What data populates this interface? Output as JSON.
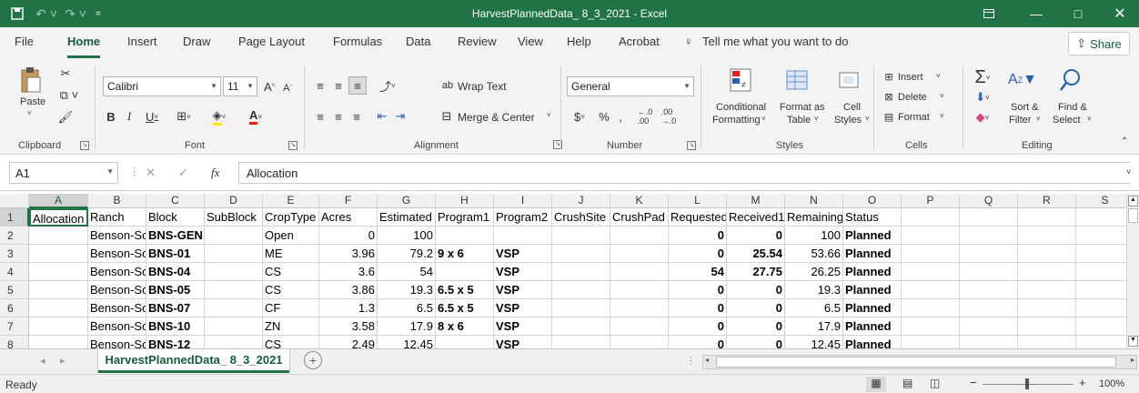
{
  "title_bar": {
    "title": "HarvestPlannedData_ 8_3_2021  -  Excel"
  },
  "tabs": [
    "File",
    "Home",
    "Insert",
    "Draw",
    "Page Layout",
    "Formulas",
    "Data",
    "Review",
    "View",
    "Help",
    "Acrobat"
  ],
  "active_tab": "Home",
  "tell_me": "Tell me what you want to do",
  "share_label": "Share",
  "ribbon": {
    "clipboard": {
      "label": "Clipboard",
      "paste": "Paste"
    },
    "font": {
      "label": "Font",
      "name": "Calibri",
      "size": "11"
    },
    "alignment": {
      "label": "Alignment",
      "wrap_text": "Wrap Text",
      "merge_center": "Merge & Center"
    },
    "number": {
      "label": "Number",
      "format": "General"
    },
    "styles": {
      "label": "Styles",
      "conditional_1": "Conditional",
      "conditional_2": "Formatting",
      "format_as_1": "Format as",
      "format_as_2": "Table",
      "cell_1": "Cell",
      "cell_2": "Styles"
    },
    "cells": {
      "label": "Cells",
      "insert": "Insert",
      "delete": "Delete",
      "format": "Format"
    },
    "editing": {
      "label": "Editing",
      "sort_1": "Sort &",
      "sort_2": "Filter",
      "find_1": "Find &",
      "find_2": "Select"
    }
  },
  "formula_bar": {
    "name_box": "A1",
    "fx": "fx",
    "content": "Allocation"
  },
  "columns": [
    "A",
    "B",
    "C",
    "D",
    "E",
    "F",
    "G",
    "H",
    "I",
    "J",
    "K",
    "L",
    "M",
    "N",
    "O",
    "P",
    "Q",
    "R",
    "S"
  ],
  "rows": [
    {
      "n": "1",
      "cells": [
        "Allocation",
        "Ranch",
        "Block",
        "SubBlock",
        "CropType",
        "Acres",
        "Estimated",
        "Program1",
        "Program2",
        "CrushSite",
        "CrushPad",
        "Requested",
        "Received1",
        "Remaining",
        "Status"
      ]
    },
    {
      "n": "2",
      "cells": [
        "",
        "Benson-Sonoma",
        "BNS-GEN",
        "",
        "Open",
        "0",
        "100",
        "",
        "",
        "",
        "",
        "0",
        "0",
        "100",
        "Planned"
      ]
    },
    {
      "n": "3",
      "cells": [
        "",
        "Benson-Sonoma",
        "BNS-01",
        "",
        "ME",
        "3.96",
        "79.2",
        "9 x 6",
        "VSP",
        "",
        "",
        "0",
        "25.54",
        "53.66",
        "Planned"
      ]
    },
    {
      "n": "4",
      "cells": [
        "",
        "Benson-Sonoma",
        "BNS-04",
        "",
        "CS",
        "3.6",
        "54",
        "",
        "VSP",
        "",
        "",
        "54",
        "27.75",
        "26.25",
        "Planned"
      ]
    },
    {
      "n": "5",
      "cells": [
        "",
        "Benson-Sonoma",
        "BNS-05",
        "",
        "CS",
        "3.86",
        "19.3",
        "6.5 x 5",
        "VSP",
        "",
        "",
        "0",
        "0",
        "19.3",
        "Planned"
      ]
    },
    {
      "n": "6",
      "cells": [
        "",
        "Benson-Sonoma",
        "BNS-07",
        "",
        "CF",
        "1.3",
        "6.5",
        "6.5 x 5",
        "VSP",
        "",
        "",
        "0",
        "0",
        "6.5",
        "Planned"
      ]
    },
    {
      "n": "7",
      "cells": [
        "",
        "Benson-Sonoma",
        "BNS-10",
        "",
        "ZN",
        "3.58",
        "17.9",
        "8 x 6",
        "VSP",
        "",
        "",
        "0",
        "0",
        "17.9",
        "Planned"
      ]
    },
    {
      "n": "8",
      "cells": [
        "",
        "Benson-Sonoma",
        "BNS-12",
        "",
        "CS",
        "2.49",
        "12.45",
        "",
        "VSP",
        "",
        "",
        "0",
        "0",
        "12.45",
        "Planned"
      ]
    }
  ],
  "sheet_tab": "HarvestPlannedData_ 8_3_2021",
  "status": {
    "ready": "Ready",
    "zoom": "100%"
  }
}
